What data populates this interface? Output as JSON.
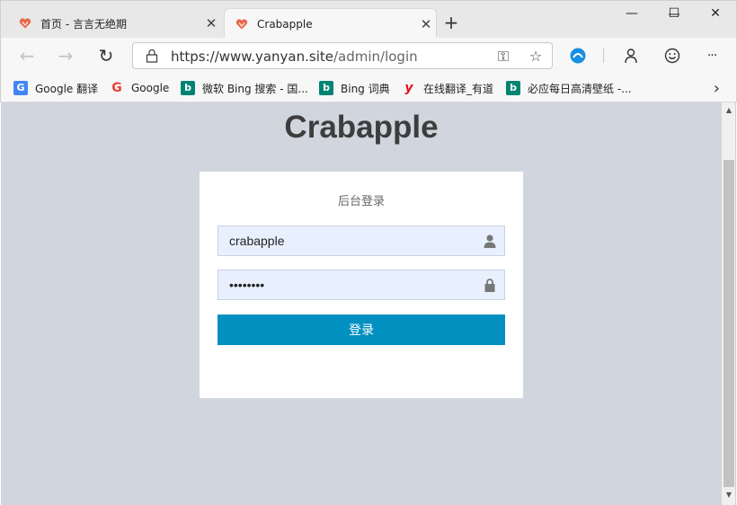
{
  "tabs": [
    {
      "title": "首页 - 言言无绝期",
      "close": "✕"
    },
    {
      "title": "Crabapple",
      "close": "✕"
    }
  ],
  "new_tab": "+",
  "window_controls": {
    "minimize": "—",
    "maximize": "☐",
    "close": "✕"
  },
  "toolbar": {
    "back": "←",
    "forward": "→",
    "refresh": "↻",
    "url_host": "https://www.yanyan.site",
    "url_path": "/admin/login",
    "key_icon": "⚿",
    "star_icon": "☆",
    "more": "···"
  },
  "bookmarks": [
    {
      "label": "Google 翻译",
      "icon": "G",
      "color": "#4285f4"
    },
    {
      "label": "Google",
      "icon": "G",
      "color": "#ea4335"
    },
    {
      "label": "微软 Bing 搜索 - 国...",
      "icon": "b",
      "color": "#008373"
    },
    {
      "label": "Bing 词典",
      "icon": "b",
      "color": "#008373"
    },
    {
      "label": "在线翻译_有道",
      "icon": "y",
      "color": "#e5101d"
    },
    {
      "label": "必应每日高清壁纸 -...",
      "icon": "b",
      "color": "#008373"
    }
  ],
  "bookmarks_more": "›",
  "page": {
    "brand": "Crabapple",
    "card_title": "后台登录",
    "username_value": "crabapple",
    "password_value": "password",
    "login_label": "登录"
  },
  "colors": {
    "page_bg": "#d1d5dd",
    "button_bg": "#0190bf",
    "input_bg": "#e8f0fe"
  }
}
